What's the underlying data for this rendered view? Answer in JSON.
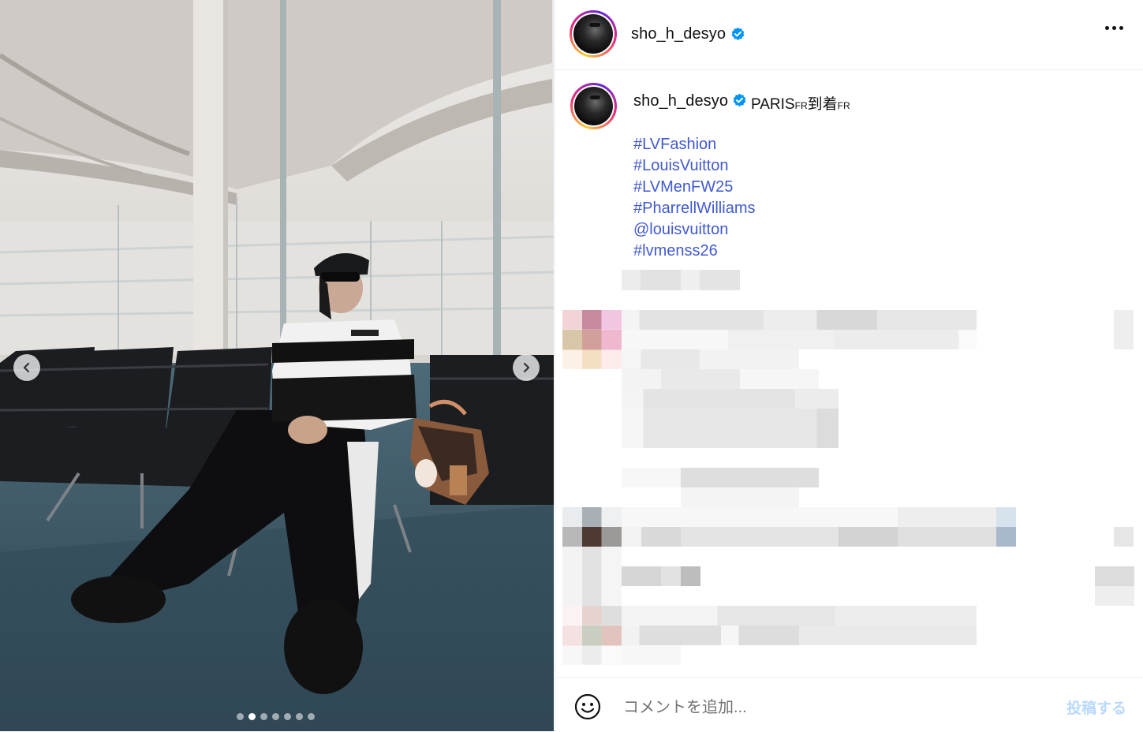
{
  "post": {
    "username": "sho_h_desyo",
    "verified": true,
    "caption": "PARIS",
    "caption_flag_1": "FR",
    "caption_mid": "到着",
    "caption_flag_2": "FR",
    "hashtags": [
      "#LVFashion",
      "#LouisVuitton",
      "#LVMenFW25",
      "#PharrellWilliams",
      "@louisvuitton",
      "#lvmenss26"
    ]
  },
  "carousel": {
    "total_slides": 7,
    "active_index": 1
  },
  "footer": {
    "comment_placeholder": "コメントを追加...",
    "post_label": "投稿する"
  },
  "icons": {
    "more": "more-options-icon",
    "verified": "verified-badge-icon",
    "emoji": "emoji-icon",
    "prev": "chevron-left-icon",
    "next": "chevron-right-icon"
  },
  "colors": {
    "link": "#4159d1",
    "verified": "#0095f6",
    "post_disabled": "#b9d9fb"
  }
}
